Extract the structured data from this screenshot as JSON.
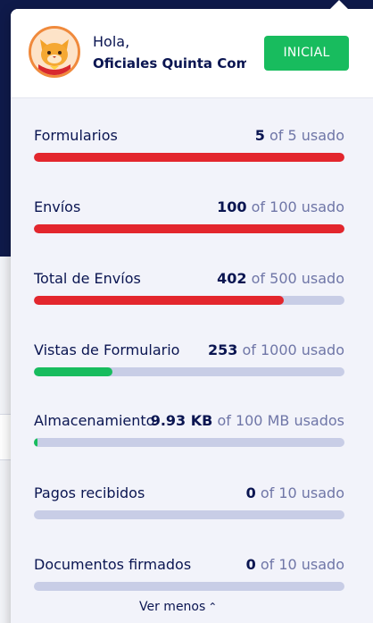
{
  "header": {
    "greeting": "Hola,",
    "user_name": "Oficiales Quinta Compañía",
    "plan_label": "INICIAL",
    "plan_color": "#18bc5e"
  },
  "usage": [
    {
      "label": "Formularios",
      "used": "5",
      "rest": "of 5 usado",
      "fraction": 1.0,
      "color": "#e3262d"
    },
    {
      "label": "Envíos",
      "used": "100",
      "rest": "of 100 usado",
      "fraction": 1.0,
      "color": "#e3262d"
    },
    {
      "label": "Total de Envíos",
      "used": "402",
      "rest": "of 500 usado",
      "fraction": 0.804,
      "color": "#e3262d"
    },
    {
      "label": "Vistas de Formulario",
      "used": "253",
      "rest": "of 1000 usado",
      "fraction": 0.253,
      "color": "#18bc5e"
    },
    {
      "label": "Almacenamiento",
      "used": "9.93 KB",
      "rest": "of 100 MB usados",
      "fraction": 0.0001,
      "color": "#18bc5e"
    },
    {
      "label": "Pagos recibidos",
      "used": "0",
      "rest": "of 10 usado",
      "fraction": 0,
      "color": "#18bc5e"
    },
    {
      "label": "Documentos firmados",
      "used": "0",
      "rest": "of 10 usado",
      "fraction": 0,
      "color": "#18bc5e"
    }
  ],
  "footer": {
    "toggle_label": "Ver menos"
  },
  "colors": {
    "track": "#c8cde6",
    "text": "#0a1551",
    "muted": "#6f76a7"
  },
  "icons": {
    "avatar": "cat-avatar-icon",
    "toggle": "chevron-up-icon"
  }
}
